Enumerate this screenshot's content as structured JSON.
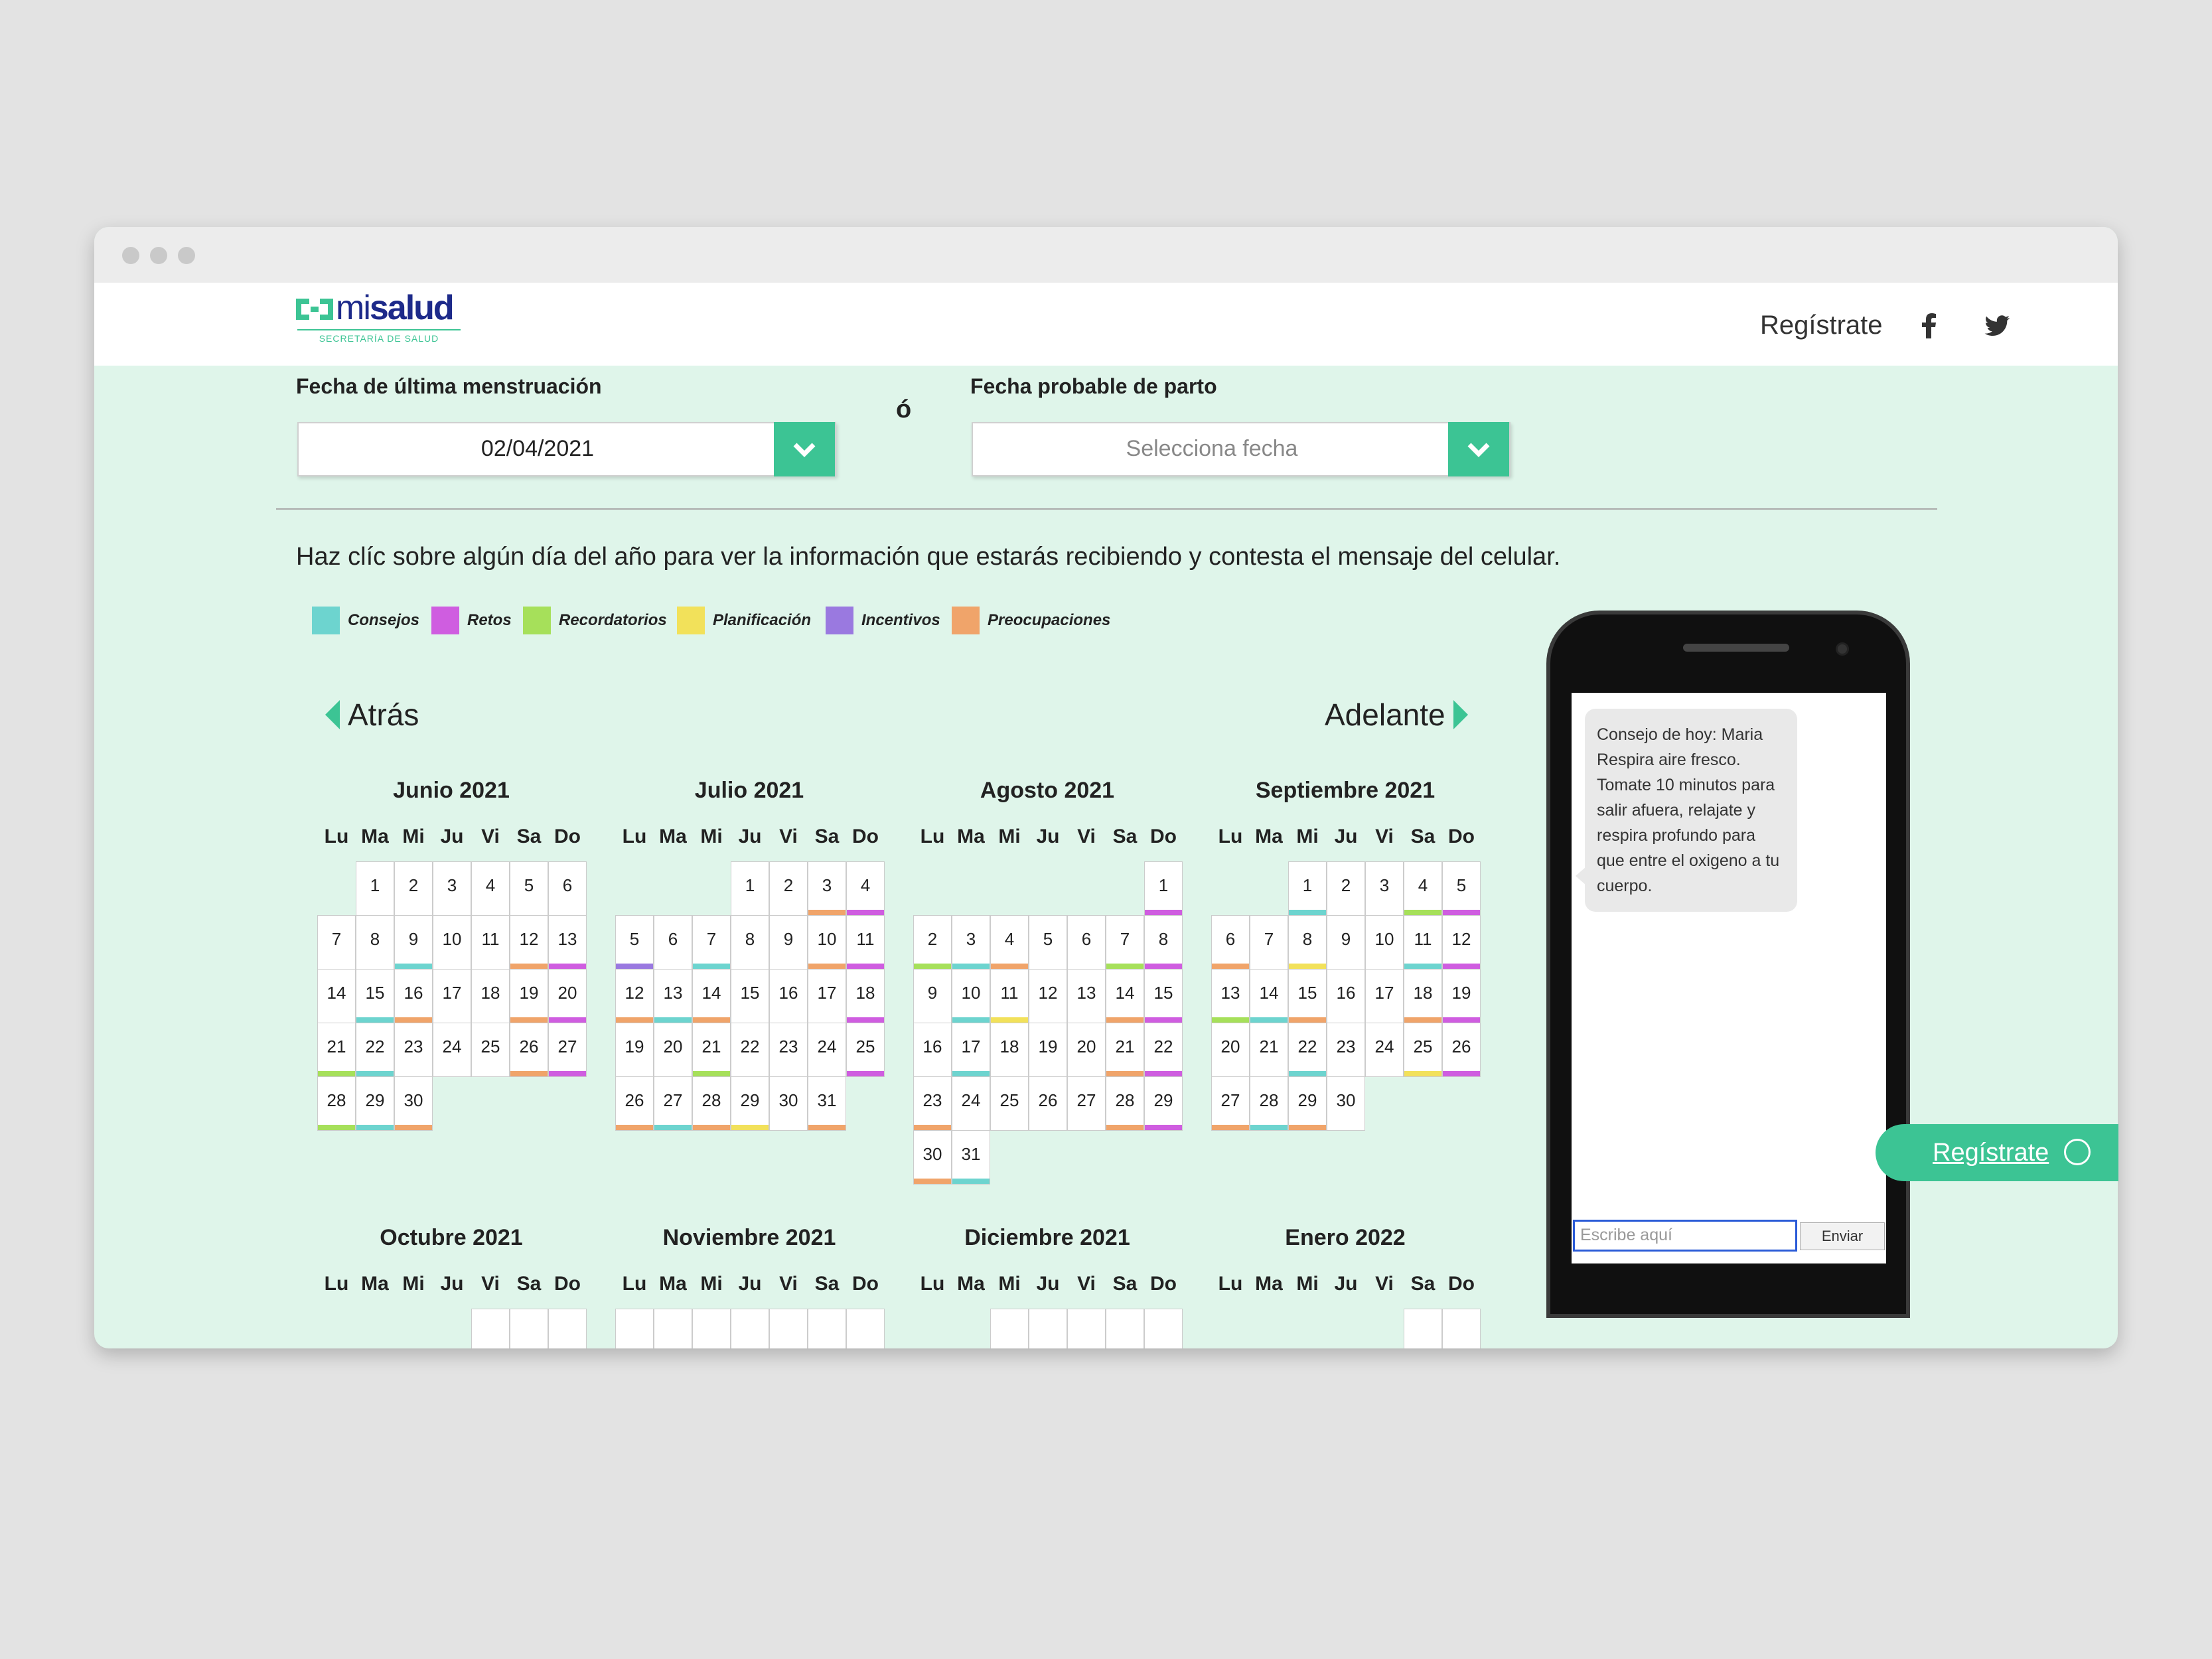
{
  "header": {
    "register_label": "Regístrate",
    "logo_text_mi": "mi",
    "logo_text_salud": "salud",
    "logo_sub": "SECRETARÍA DE SALUD"
  },
  "form": {
    "lmp_label": "Fecha de última menstruación",
    "lmp_value": "02/04/2021",
    "or_label": "ó",
    "due_label": "Fecha probable de parto",
    "due_placeholder": "Selecciona fecha"
  },
  "instructions": "Haz clíc sobre algún día del año para ver la información que estarás recibiendo y contesta el mensaje del celular.",
  "legend": [
    {
      "label": "Consejos",
      "color": "#6dd4cf"
    },
    {
      "label": "Retos",
      "color": "#cf5de0"
    },
    {
      "label": "Recordatorios",
      "color": "#a6e05a"
    },
    {
      "label": "Planificación",
      "color": "#f2e15a"
    },
    {
      "label": "Incentivos",
      "color": "#9a79e0"
    },
    {
      "label": "Preocupaciones",
      "color": "#f0a46a"
    }
  ],
  "nav": {
    "back_label": "Atrás",
    "forward_label": "Adelante"
  },
  "weekdays": [
    "Lu",
    "Ma",
    "Mi",
    "Ju",
    "Vi",
    "Sa",
    "Do"
  ],
  "months": [
    {
      "title": "Junio 2021",
      "start": 1,
      "days": 30,
      "marks": {
        "9": "Consejos",
        "12": "Preocupaciones",
        "13": "Retos",
        "15": "Consejos",
        "16": "Preocupaciones",
        "19": "Preocupaciones",
        "20": "Retos",
        "21": "Recordatorios",
        "22": "Consejos",
        "26": "Preocupaciones",
        "27": "Retos",
        "28": "Recordatorios",
        "29": "Consejos",
        "30": "Preocupaciones"
      }
    },
    {
      "title": "Julio 2021",
      "start": 3,
      "days": 31,
      "marks": {
        "3": "Preocupaciones",
        "4": "Retos",
        "5": "Incentivos",
        "7": "Consejos",
        "10": "Preocupaciones",
        "11": "Retos",
        "12": "Preocupaciones",
        "13": "Consejos",
        "14": "Preocupaciones",
        "18": "Retos",
        "21": "Recordatorios",
        "25": "Retos",
        "26": "Preocupaciones",
        "27": "Consejos",
        "28": "Preocupaciones",
        "29": "Planificación",
        "31": "Preocupaciones"
      }
    },
    {
      "title": "Agosto 2021",
      "start": 6,
      "days": 31,
      "marks": {
        "1": "Retos",
        "2": "Recordatorios",
        "3": "Consejos",
        "4": "Preocupaciones",
        "7": "Recordatorios",
        "8": "Retos",
        "10": "Consejos",
        "11": "Planificación",
        "14": "Preocupaciones",
        "15": "Retos",
        "17": "Consejos",
        "21": "Preocupaciones",
        "22": "Retos",
        "23": "Preocupaciones",
        "28": "Preocupaciones",
        "29": "Retos",
        "30": "Preocupaciones",
        "31": "Consejos"
      }
    },
    {
      "title": "Septiembre 2021",
      "start": 2,
      "days": 30,
      "marks": {
        "1": "Consejos",
        "4": "Recordatorios",
        "5": "Retos",
        "6": "Preocupaciones",
        "8": "Planificación",
        "11": "Consejos",
        "12": "Retos",
        "13": "Recordatorios",
        "14": "Consejos",
        "15": "Preocupaciones",
        "18": "Preocupaciones",
        "19": "Retos",
        "22": "Consejos",
        "25": "Planificación",
        "26": "Retos",
        "27": "Preocupaciones",
        "28": "Consejos",
        "29": "Preocupaciones"
      }
    },
    {
      "title": "Octubre 2021",
      "start": 4,
      "days": 0,
      "marks": {}
    },
    {
      "title": "Noviembre 2021",
      "start": 0,
      "days": 0,
      "marks": {}
    },
    {
      "title": "Diciembre 2021",
      "start": 2,
      "days": 0,
      "marks": {}
    },
    {
      "title": "Enero 2022",
      "start": 5,
      "days": 0,
      "marks": {}
    }
  ],
  "phone": {
    "message": "Consejo de hoy: Maria Respira aire fresco. Tomate 10 minutos para salir afuera, relajate y respira profundo para que entre el oxigeno a tu cuerpo.",
    "input_placeholder": "Escribe aquí",
    "send_label": "Enviar"
  },
  "floating_register_label": "Regístrate",
  "colors": {
    "accent": "#3cc494",
    "background": "#dff5ea"
  }
}
